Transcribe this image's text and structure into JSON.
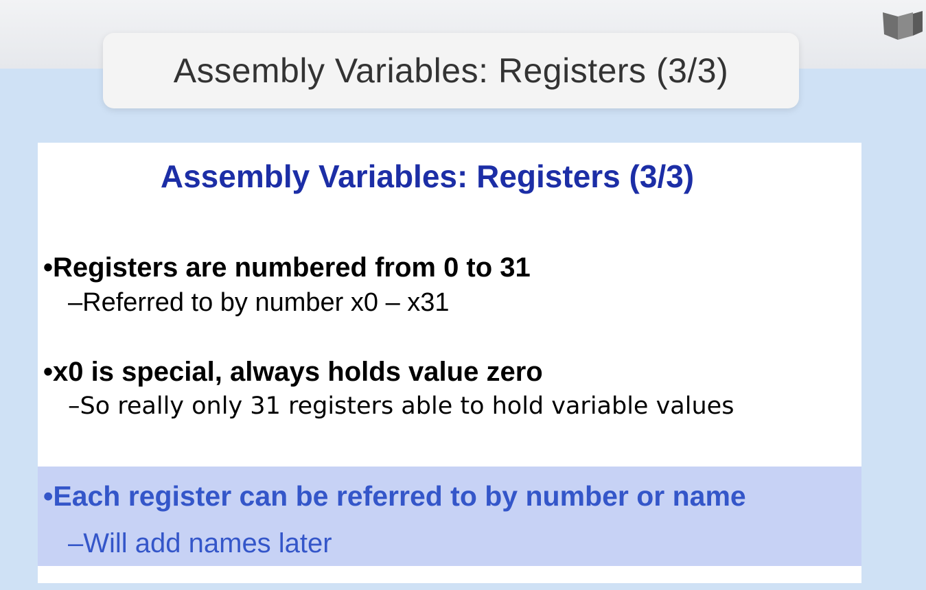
{
  "window": {
    "title": "Assembly Variables: Registers (3/3)",
    "logo_icon": "book-logo-icon"
  },
  "slide": {
    "title": "Assembly Variables: Registers (3/3)",
    "bullets": [
      {
        "text": "•Registers are numbered from 0 to 31",
        "sub": "–Referred to by number x0 – x31"
      },
      {
        "text": "•x0 is special, always holds value zero",
        "sub": "–So really only 31 registers able to hold variable values"
      },
      {
        "text": "•Each register can be referred to by number or name",
        "sub": "–Will add names later",
        "highlighted": true
      }
    ]
  },
  "colors": {
    "background": "#cfe1f5",
    "slide_title": "#1c2ea6",
    "highlight_band": "#c7d2f5",
    "highlight_text": "#3456c9"
  }
}
